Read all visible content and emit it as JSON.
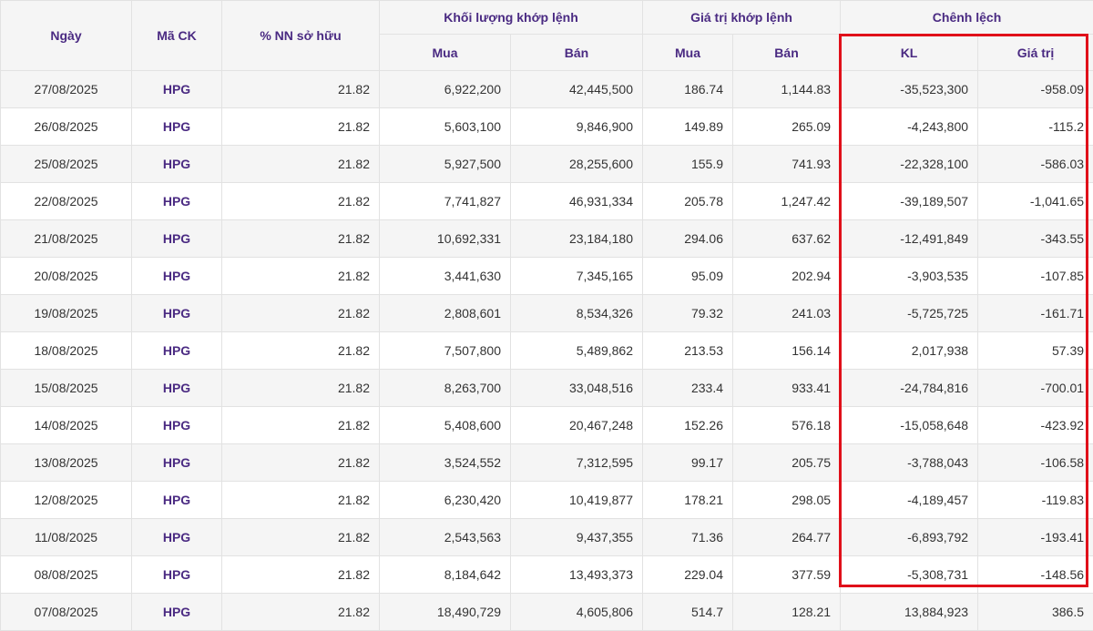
{
  "headers": {
    "date": "Ngày",
    "symbol": "Mã CK",
    "foreign_pct": "% NN sở hữu",
    "volume_group": "Khối lượng khớp lệnh",
    "value_group": "Giá trị khớp lệnh",
    "diff_group": "Chênh lệch",
    "buy": "Mua",
    "sell": "Bán",
    "diff_volume": "KL",
    "diff_value": "Giá trị"
  },
  "colors": {
    "header_text": "#4a2a82",
    "highlight_border": "#e0101a",
    "stripe": "#f5f5f5"
  },
  "rows": [
    {
      "date": "27/08/2025",
      "symbol": "HPG",
      "pct": "21.82",
      "vol_buy": "6,922,200",
      "vol_sell": "42,445,500",
      "val_buy": "186.74",
      "val_sell": "1,144.83",
      "diff_vol": "-35,523,300",
      "diff_val": "-958.09"
    },
    {
      "date": "26/08/2025",
      "symbol": "HPG",
      "pct": "21.82",
      "vol_buy": "5,603,100",
      "vol_sell": "9,846,900",
      "val_buy": "149.89",
      "val_sell": "265.09",
      "diff_vol": "-4,243,800",
      "diff_val": "-115.2"
    },
    {
      "date": "25/08/2025",
      "symbol": "HPG",
      "pct": "21.82",
      "vol_buy": "5,927,500",
      "vol_sell": "28,255,600",
      "val_buy": "155.9",
      "val_sell": "741.93",
      "diff_vol": "-22,328,100",
      "diff_val": "-586.03"
    },
    {
      "date": "22/08/2025",
      "symbol": "HPG",
      "pct": "21.82",
      "vol_buy": "7,741,827",
      "vol_sell": "46,931,334",
      "val_buy": "205.78",
      "val_sell": "1,247.42",
      "diff_vol": "-39,189,507",
      "diff_val": "-1,041.65"
    },
    {
      "date": "21/08/2025",
      "symbol": "HPG",
      "pct": "21.82",
      "vol_buy": "10,692,331",
      "vol_sell": "23,184,180",
      "val_buy": "294.06",
      "val_sell": "637.62",
      "diff_vol": "-12,491,849",
      "diff_val": "-343.55"
    },
    {
      "date": "20/08/2025",
      "symbol": "HPG",
      "pct": "21.82",
      "vol_buy": "3,441,630",
      "vol_sell": "7,345,165",
      "val_buy": "95.09",
      "val_sell": "202.94",
      "diff_vol": "-3,903,535",
      "diff_val": "-107.85"
    },
    {
      "date": "19/08/2025",
      "symbol": "HPG",
      "pct": "21.82",
      "vol_buy": "2,808,601",
      "vol_sell": "8,534,326",
      "val_buy": "79.32",
      "val_sell": "241.03",
      "diff_vol": "-5,725,725",
      "diff_val": "-161.71"
    },
    {
      "date": "18/08/2025",
      "symbol": "HPG",
      "pct": "21.82",
      "vol_buy": "7,507,800",
      "vol_sell": "5,489,862",
      "val_buy": "213.53",
      "val_sell": "156.14",
      "diff_vol": "2,017,938",
      "diff_val": "57.39"
    },
    {
      "date": "15/08/2025",
      "symbol": "HPG",
      "pct": "21.82",
      "vol_buy": "8,263,700",
      "vol_sell": "33,048,516",
      "val_buy": "233.4",
      "val_sell": "933.41",
      "diff_vol": "-24,784,816",
      "diff_val": "-700.01"
    },
    {
      "date": "14/08/2025",
      "symbol": "HPG",
      "pct": "21.82",
      "vol_buy": "5,408,600",
      "vol_sell": "20,467,248",
      "val_buy": "152.26",
      "val_sell": "576.18",
      "diff_vol": "-15,058,648",
      "diff_val": "-423.92"
    },
    {
      "date": "13/08/2025",
      "symbol": "HPG",
      "pct": "21.82",
      "vol_buy": "3,524,552",
      "vol_sell": "7,312,595",
      "val_buy": "99.17",
      "val_sell": "205.75",
      "diff_vol": "-3,788,043",
      "diff_val": "-106.58"
    },
    {
      "date": "12/08/2025",
      "symbol": "HPG",
      "pct": "21.82",
      "vol_buy": "6,230,420",
      "vol_sell": "10,419,877",
      "val_buy": "178.21",
      "val_sell": "298.05",
      "diff_vol": "-4,189,457",
      "diff_val": "-119.83"
    },
    {
      "date": "11/08/2025",
      "symbol": "HPG",
      "pct": "21.82",
      "vol_buy": "2,543,563",
      "vol_sell": "9,437,355",
      "val_buy": "71.36",
      "val_sell": "264.77",
      "diff_vol": "-6,893,792",
      "diff_val": "-193.41"
    },
    {
      "date": "08/08/2025",
      "symbol": "HPG",
      "pct": "21.82",
      "vol_buy": "8,184,642",
      "vol_sell": "13,493,373",
      "val_buy": "229.04",
      "val_sell": "377.59",
      "diff_vol": "-5,308,731",
      "diff_val": "-148.56"
    },
    {
      "date": "07/08/2025",
      "symbol": "HPG",
      "pct": "21.82",
      "vol_buy": "18,490,729",
      "vol_sell": "4,605,806",
      "val_buy": "514.7",
      "val_sell": "128.21",
      "diff_vol": "13,884,923",
      "diff_val": "386.5"
    }
  ]
}
